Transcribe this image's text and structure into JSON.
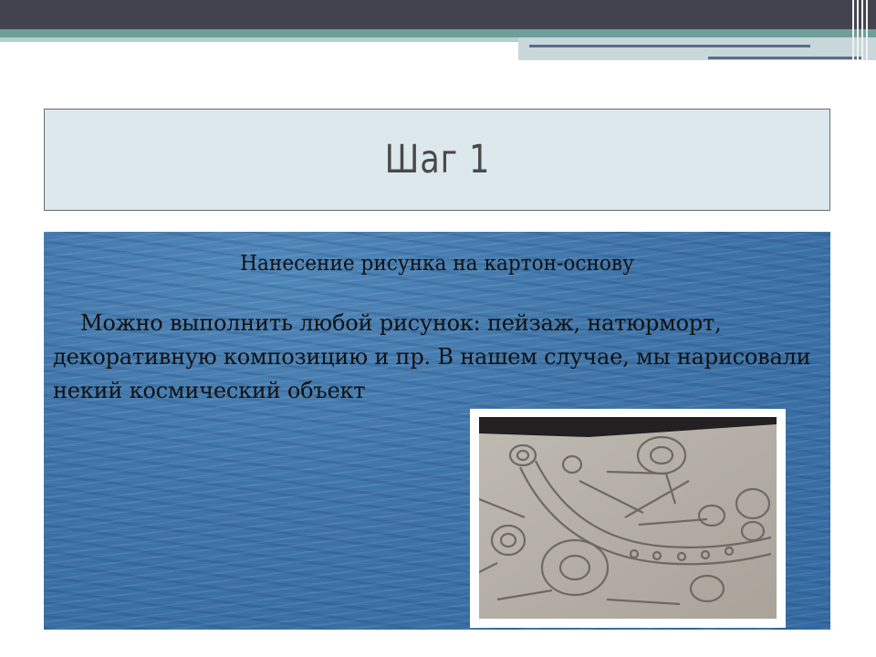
{
  "slide": {
    "title": "Шаг 1",
    "subtitle": "Нанесение рисунка на картон-основу",
    "body": "Можно выполнить любой рисунок: пейзаж, натюрморт, декоративную композицию и пр. В нашем случае, мы нарисовали некий космический объект"
  },
  "colors": {
    "top_band": "#43434f",
    "accent_teal": "#6f9e9b",
    "title_box_bg": "#dde8ed",
    "water": "#3f74a8"
  },
  "image": {
    "description_icon": "photo-icon"
  }
}
